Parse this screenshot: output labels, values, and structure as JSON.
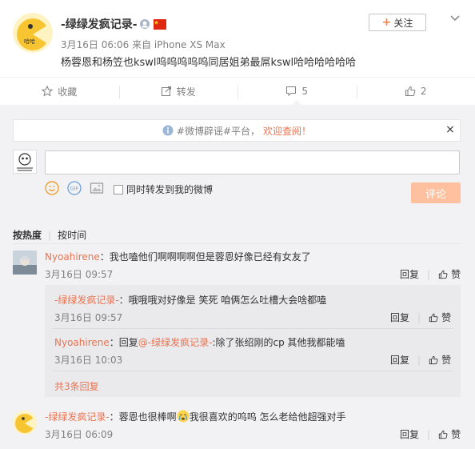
{
  "post": {
    "username": "-绿绿发疯记录-",
    "meta": "3月16日 06:06 来自 iPhone XS Max",
    "text": "杨蓉恩和杨笠也kswl呜呜呜呜呜同居姐弟最屌kswl哈哈哈哈哈哈",
    "follow_label": "关注",
    "follow_icon": "+"
  },
  "actions": [
    {
      "name": "favorite",
      "label": "收藏",
      "icon": "star-icon"
    },
    {
      "name": "repost",
      "label": "转发",
      "icon": "repost-icon"
    },
    {
      "name": "comment",
      "label": "5",
      "icon": "comment-icon"
    },
    {
      "name": "like",
      "label": "2",
      "icon": "thumbs-up-icon"
    }
  ],
  "notice": {
    "prefix": "#微博辟谣#平台，",
    "link": "欢迎查阅！",
    "close": "×"
  },
  "composer": {
    "placeholder": "",
    "forward_label": "同时转发到我的微博",
    "submit_label": "评论"
  },
  "sort": {
    "hot": "按热度",
    "time": "按时间"
  },
  "comments": [
    {
      "user": "Nyoahirene",
      "text": "：我也嗑他们啊啊啊啊但是蓉恩好像已经有女友了",
      "time": "3月16日 09:57",
      "reply_label": "回复",
      "like_label": "赞"
    },
    {
      "user": "-绿绿发疯记录-",
      "text_before": "：蓉恩也很棒啊",
      "text_after": "我很喜欢的呜呜 怎么老给他超强对手",
      "time": "3月16日 06:09",
      "reply_label": "回复",
      "like_label": "赞"
    }
  ],
  "replies": [
    {
      "user": "-绿绿发疯记录-",
      "text": "：哦哦哦对好像是 笑死 咱俩怎么吐槽大会啥都嗑",
      "time": "3月16日 09:57",
      "reply_label": "回复",
      "like_label": "赞"
    },
    {
      "user": "Nyoahirene",
      "prefix": "：回复",
      "mention": "@-绿绿发疯记录-",
      "text": ":除了张绍刚的cp 其他我都能嗑",
      "time": "3月16日 10:03",
      "reply_label": "回复",
      "like_label": "赞"
    }
  ],
  "more_replies": "共3条回复",
  "colors": {
    "accent": "#eb7350",
    "submit_disabled": "#ffc09f",
    "comment_bg": "#f2f2f5"
  }
}
